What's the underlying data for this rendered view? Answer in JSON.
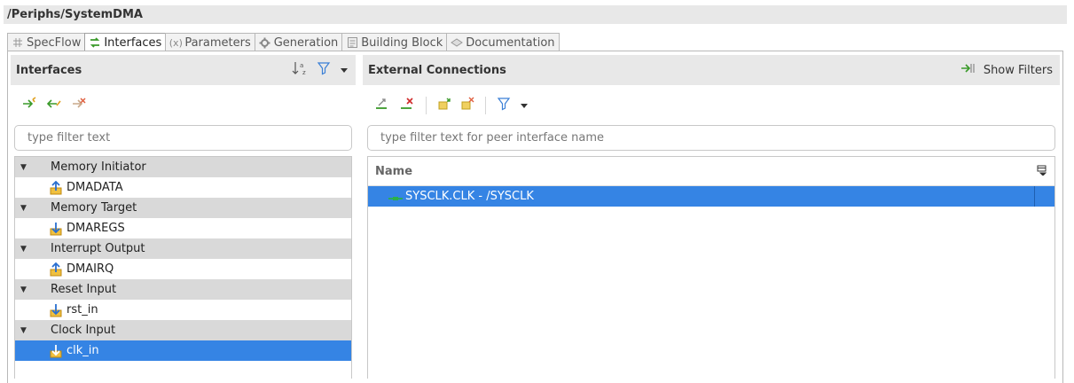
{
  "window": {
    "title": "/Periphs/SystemDMA"
  },
  "tabs": [
    {
      "label": "SpecFlow",
      "icon": "grid-icon",
      "active": false
    },
    {
      "label": "Interfaces",
      "icon": "interfaces-icon",
      "active": true
    },
    {
      "label": "Parameters",
      "icon": "parameters-icon",
      "active": false
    },
    {
      "label": "Generation",
      "icon": "generation-icon",
      "active": false
    },
    {
      "label": "Building Block",
      "icon": "building-block-icon",
      "active": false
    },
    {
      "label": "Documentation",
      "icon": "documentation-icon",
      "active": false
    }
  ],
  "left_panel": {
    "title": "Interfaces",
    "filter_placeholder": "type filter text",
    "groups": [
      {
        "label": "Memory Initiator",
        "items": [
          {
            "label": "DMADATA",
            "icon": "initiator-icon",
            "selected": false
          }
        ]
      },
      {
        "label": "Memory Target",
        "items": [
          {
            "label": "DMAREGS",
            "icon": "target-icon",
            "selected": false
          }
        ]
      },
      {
        "label": "Interrupt Output",
        "items": [
          {
            "label": "DMAIRQ",
            "icon": "initiator-icon",
            "selected": false
          }
        ]
      },
      {
        "label": "Reset Input",
        "items": [
          {
            "label": "rst_in",
            "icon": "target-icon",
            "selected": false
          }
        ]
      },
      {
        "label": "Clock Input",
        "items": [
          {
            "label": "clk_in",
            "icon": "target-icon",
            "selected": true
          }
        ]
      }
    ]
  },
  "right_panel": {
    "title": "External Connections",
    "show_filters_label": "Show Filters",
    "filter_placeholder": "type filter text for peer interface name",
    "table": {
      "columns": [
        "Name"
      ],
      "rows": [
        {
          "name": "SYSCLK.CLK - /SYSCLK",
          "selected": true
        }
      ]
    }
  },
  "colors": {
    "selection": "#3584e4",
    "header_bg": "#e8e8e8",
    "group_bg": "#d9d9d9"
  }
}
